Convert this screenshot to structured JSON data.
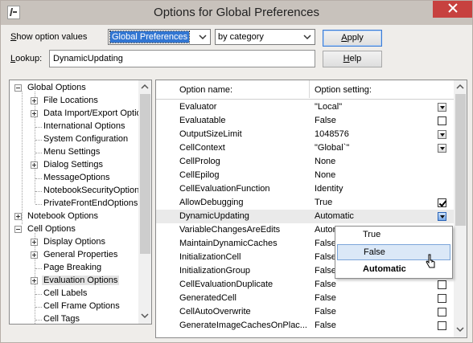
{
  "window": {
    "title": "Options for Global Preferences"
  },
  "controls": {
    "show_label_prefix": "S",
    "show_label_rest": "how option values",
    "scope_value": "Global Preferences",
    "sort_value": "by category",
    "lookup_label_prefix": "L",
    "lookup_label_rest": "ookup:",
    "lookup_value": "DynamicUpdating",
    "apply_label_prefix": "A",
    "apply_label_rest": "pply",
    "help_label_prefix": "H",
    "help_label_rest": "elp"
  },
  "tree": {
    "items": [
      {
        "label": "Global Options"
      },
      {
        "label": "File Locations"
      },
      {
        "label": "Data Import/Export Optio"
      },
      {
        "label": "International Options"
      },
      {
        "label": "System Configuration"
      },
      {
        "label": "Menu Settings"
      },
      {
        "label": "Dialog Settings"
      },
      {
        "label": "MessageOptions"
      },
      {
        "label": "NotebookSecurityOptions"
      },
      {
        "label": "PrivateFrontEndOptions"
      },
      {
        "label": "Notebook Options"
      },
      {
        "label": "Cell Options"
      },
      {
        "label": "Display Options"
      },
      {
        "label": "General Properties"
      },
      {
        "label": "Page Breaking"
      },
      {
        "label": "Evaluation Options"
      },
      {
        "label": "Cell Labels"
      },
      {
        "label": "Cell Frame Options"
      },
      {
        "label": "Cell Tags"
      }
    ]
  },
  "table": {
    "header_name": "Option name:",
    "header_setting": "Option setting:",
    "rows": [
      {
        "name": "Evaluator",
        "value": "\"Local\""
      },
      {
        "name": "Evaluatable",
        "value": "False"
      },
      {
        "name": "OutputSizeLimit",
        "value": "1048576"
      },
      {
        "name": "CellContext",
        "value": "\"Global`\""
      },
      {
        "name": "CellProlog",
        "value": "None"
      },
      {
        "name": "CellEpilog",
        "value": "None"
      },
      {
        "name": "CellEvaluationFunction",
        "value": "Identity"
      },
      {
        "name": "AllowDebugging",
        "value": "True"
      },
      {
        "name": "DynamicUpdating",
        "value": "Automatic"
      },
      {
        "name": "VariableChangesAreEdits",
        "value": "Autor"
      },
      {
        "name": "MaintainDynamicCaches",
        "value": "False"
      },
      {
        "name": "InitializationCell",
        "value": "False"
      },
      {
        "name": "InitializationGroup",
        "value": "False"
      },
      {
        "name": "CellEvaluationDuplicate",
        "value": "False"
      },
      {
        "name": "GeneratedCell",
        "value": "False"
      },
      {
        "name": "CellAutoOverwrite",
        "value": "False"
      },
      {
        "name": "GenerateImageCachesOnPlac...",
        "value": "False"
      }
    ]
  },
  "popup": {
    "items": [
      {
        "label": "True"
      },
      {
        "label": "False"
      },
      {
        "label": "Automatic"
      }
    ]
  },
  "colors": {
    "titlebar": "#c8c2bc",
    "close": "#c7413f",
    "selection": "#3276d2",
    "popup_hover": "#dbe8f7"
  },
  "icons": [
    "app-icon",
    "close-icon",
    "chevron-down-icon",
    "checkbox-icon",
    "cursor-icon"
  ]
}
